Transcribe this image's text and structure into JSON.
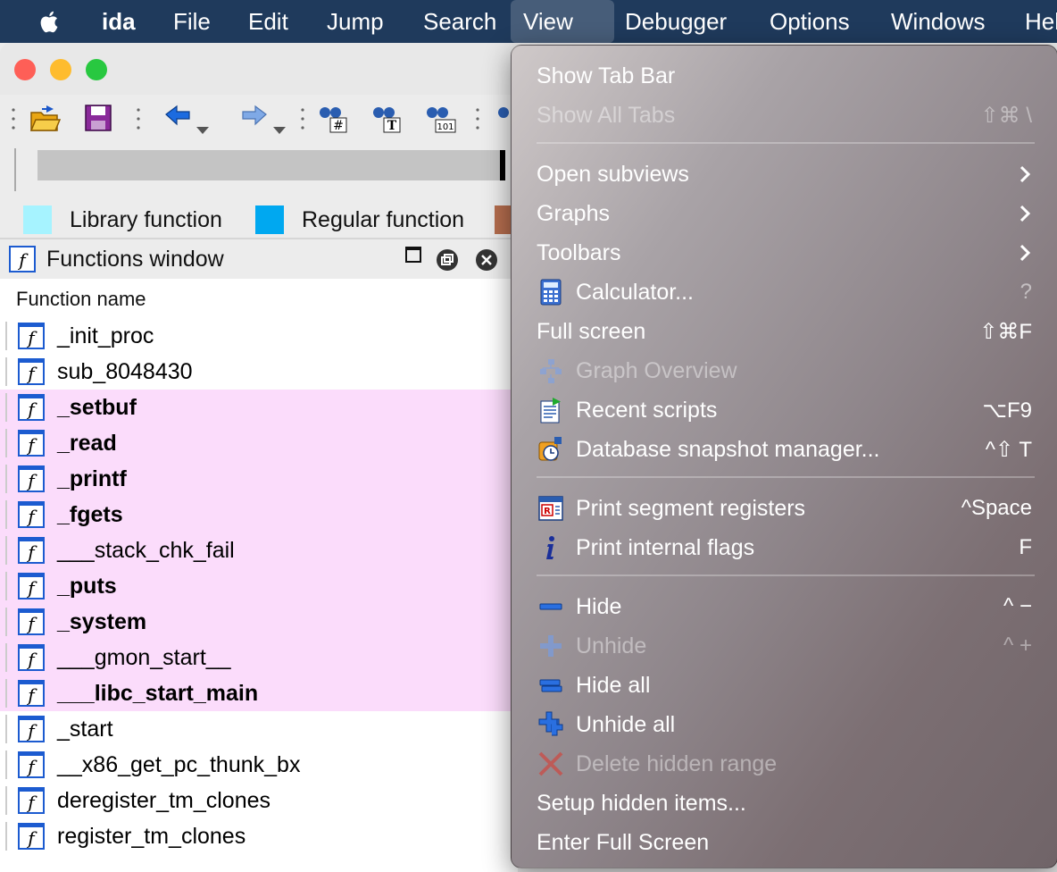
{
  "menubar": {
    "items": [
      {
        "label": "ida"
      },
      {
        "label": "File"
      },
      {
        "label": "Edit"
      },
      {
        "label": "Jump"
      },
      {
        "label": "Search"
      },
      {
        "label": "View"
      },
      {
        "label": "Debugger"
      },
      {
        "label": "Options"
      },
      {
        "label": "Windows"
      },
      {
        "label": "Hel"
      }
    ]
  },
  "legend": {
    "library": {
      "label": "Library function",
      "color": "#a6f3ff"
    },
    "regular": {
      "label": "Regular function",
      "color": "#00a8f0"
    },
    "extra_color": "#b56d4e"
  },
  "functions_window": {
    "title": "Functions window",
    "column_header": "Function name",
    "rows": [
      {
        "name": "_init_proc",
        "library": false
      },
      {
        "name": "sub_8048430",
        "library": false
      },
      {
        "name": "_setbuf",
        "library": true
      },
      {
        "name": "_read",
        "library": true
      },
      {
        "name": "_printf",
        "library": true
      },
      {
        "name": "_fgets",
        "library": true
      },
      {
        "name": "___stack_chk_fail",
        "library": true,
        "bold": false
      },
      {
        "name": "_puts",
        "library": true
      },
      {
        "name": "_system",
        "library": true
      },
      {
        "name": "___gmon_start__",
        "library": true,
        "bold": false
      },
      {
        "name": "___libc_start_main",
        "library": true
      },
      {
        "name": "_start",
        "library": false
      },
      {
        "name": "__x86_get_pc_thunk_bx",
        "library": false
      },
      {
        "name": "deregister_tm_clones",
        "library": false
      },
      {
        "name": "register_tm_clones",
        "library": false
      }
    ]
  },
  "view_menu": {
    "show_tab_bar": {
      "label": "Show Tab Bar"
    },
    "show_all_tabs": {
      "label": "Show All Tabs",
      "shortcut": "⇧⌘ \\"
    },
    "open_subviews": {
      "label": "Open subviews"
    },
    "graphs": {
      "label": "Graphs"
    },
    "toolbars": {
      "label": "Toolbars"
    },
    "calculator": {
      "label": "Calculator...",
      "shortcut": "?"
    },
    "full_screen": {
      "label": "Full screen",
      "shortcut": "⇧⌘F"
    },
    "graph_overview": {
      "label": "Graph Overview"
    },
    "recent_scripts": {
      "label": "Recent scripts",
      "shortcut": "⌥F9"
    },
    "db_snapshot": {
      "label": "Database snapshot manager...",
      "shortcut": "^⇧ T"
    },
    "print_segment": {
      "label": "Print segment registers",
      "shortcut": "^Space"
    },
    "print_flags": {
      "label": "Print internal flags",
      "shortcut": "F"
    },
    "hide": {
      "label": "Hide",
      "shortcut": "^ −"
    },
    "unhide": {
      "label": "Unhide",
      "shortcut": "^ +"
    },
    "hide_all": {
      "label": "Hide all"
    },
    "unhide_all": {
      "label": "Unhide all"
    },
    "delete_hidden": {
      "label": "Delete hidden range"
    },
    "setup_hidden": {
      "label": "Setup hidden items..."
    },
    "enter_full_screen": {
      "label": "Enter Full Screen"
    }
  }
}
